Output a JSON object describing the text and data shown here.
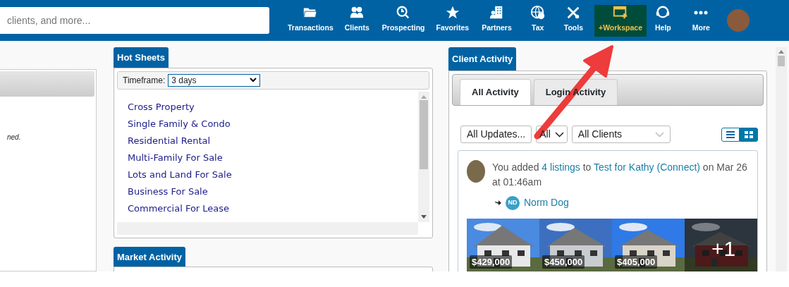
{
  "search": {
    "placeholder": "clients, and more..."
  },
  "nav": [
    {
      "label": "Transactions",
      "selected": false
    },
    {
      "label": "Clients",
      "selected": false
    },
    {
      "label": "Prospecting",
      "selected": false
    },
    {
      "label": "Favorites",
      "selected": false
    },
    {
      "label": "Partners",
      "selected": false
    },
    {
      "label": "Tax",
      "selected": false
    },
    {
      "label": "Tools",
      "selected": false
    },
    {
      "label": "+Workspace",
      "selected": true
    },
    {
      "label": "Help",
      "selected": false
    },
    {
      "label": "More",
      "selected": false
    }
  ],
  "left_panel": {
    "note": "ned."
  },
  "hot_sheets": {
    "title": "Hot Sheets",
    "timeframe_label": "Timeframe:",
    "timeframe_value": "3 days",
    "items": [
      "Cross Property",
      "Single Family & Condo",
      "Residential Rental",
      "Multi-Family For Sale",
      "Lots and Land For Sale",
      "Business For Sale",
      "Commercial For Lease"
    ]
  },
  "market_activity": {
    "title": "Market Activity"
  },
  "client_activity": {
    "title": "Client Activity",
    "tabs": [
      {
        "label": "All Activity",
        "selected": true
      },
      {
        "label": "Login Activity",
        "selected": false
      }
    ],
    "filters": [
      {
        "value": "All Updates...",
        "kind": "button"
      },
      {
        "value": "All",
        "kind": "caret"
      },
      {
        "value": "All Clients",
        "kind": "select"
      }
    ],
    "views": [
      {
        "kind": "list",
        "selected": false
      },
      {
        "kind": "grid",
        "selected": true
      }
    ],
    "activity": {
      "segments": [
        {
          "kind": "text",
          "text": "You added "
        },
        {
          "kind": "link",
          "text": "4 listings"
        },
        {
          "kind": "text",
          "text": " to "
        },
        {
          "kind": "link",
          "text": "Test for Kathy (Connect)"
        },
        {
          "kind": "text",
          "text": " on Mar 26 at 01:46am"
        }
      ],
      "client": {
        "initials": "ND",
        "name": "Norm Dog"
      },
      "photos": [
        {
          "price": "$429,000"
        },
        {
          "price": "$450,000"
        },
        {
          "price": "$405,000"
        },
        {
          "more": "+1"
        }
      ]
    }
  }
}
